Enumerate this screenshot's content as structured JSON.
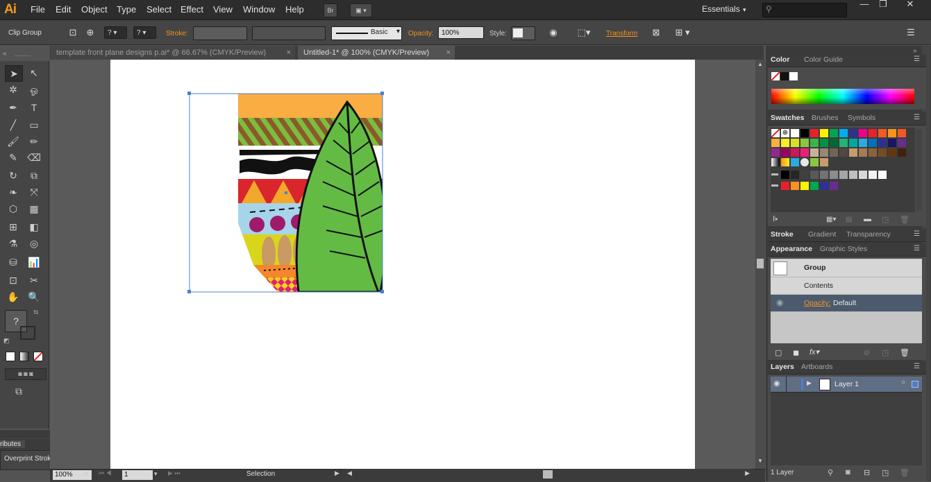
{
  "app": {
    "logo": "Ai",
    "workspace": "Essentials",
    "bridge": "Br"
  },
  "menu": [
    "File",
    "Edit",
    "Object",
    "Type",
    "Select",
    "Effect",
    "View",
    "Window",
    "Help"
  ],
  "control": {
    "selection": "Clip Group",
    "stroke_label": "Stroke:",
    "brush": "Basic",
    "opacity_label": "Opacity:",
    "opacity_value": "100%",
    "style_label": "Style:",
    "transform_label": "Transform",
    "question": "?"
  },
  "tabs": [
    {
      "label": "template front plane designs p.ai* @ 66.67% (CMYK/Preview)",
      "active": false
    },
    {
      "label": "Untitled-1* @ 100% (CMYK/Preview)",
      "active": true
    }
  ],
  "status": {
    "zoom": "100%",
    "page": "1",
    "tool": "Selection"
  },
  "panels": {
    "color_tabs": [
      "Color",
      "Color Guide"
    ],
    "swatch_tabs": [
      "Swatches",
      "Brushes",
      "Symbols"
    ],
    "stroke_tabs": [
      "Stroke",
      "Gradient",
      "Transparency"
    ],
    "appearance_tabs": [
      "Appearance",
      "Graphic Styles"
    ],
    "appearance": {
      "group": "Group",
      "contents": "Contents",
      "opacity_label": "Opacity:",
      "opacity_value": "Default"
    },
    "layers_tabs": [
      "Layers",
      "Artboards"
    ],
    "layer_name": "Layer 1",
    "layer_count": "1 Layer"
  },
  "left_panel": {
    "tab": "ributes",
    "item": "Overprint Stroke"
  },
  "colors": {
    "accent_orange": "#f3931f",
    "selection_blue": "#4a7fd6"
  }
}
